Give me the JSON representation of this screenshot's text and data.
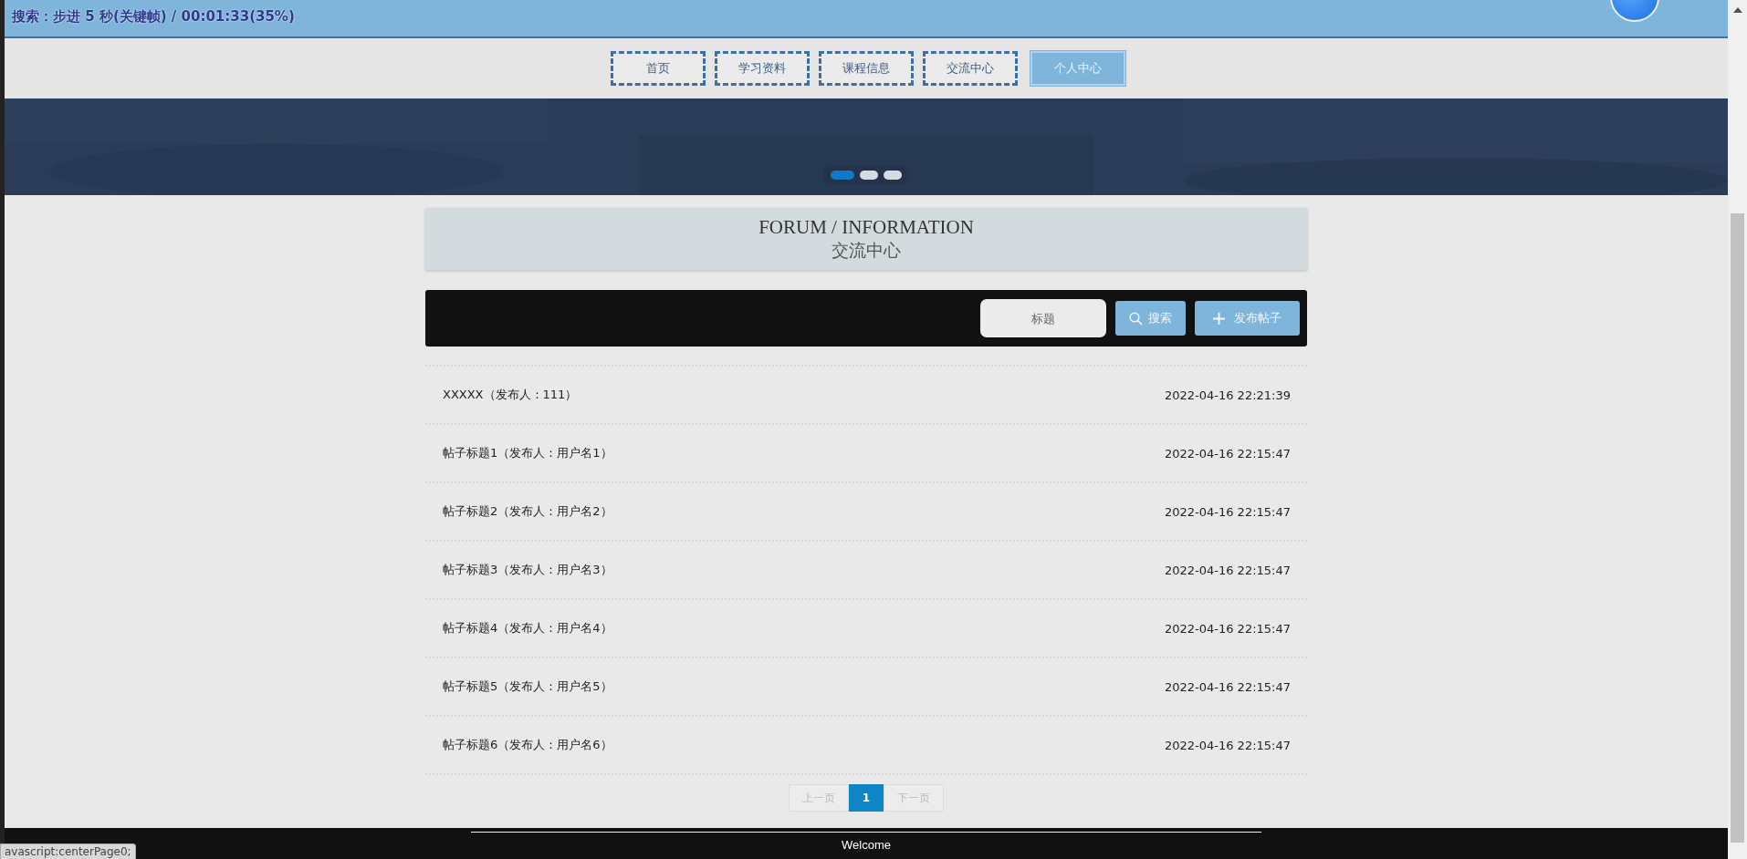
{
  "header": {
    "overlay_text": "搜索：步进 5 秒(关键帧) / 00:01:33(35%)"
  },
  "nav": [
    {
      "label": "首页",
      "selected": false
    },
    {
      "label": "学习资料",
      "selected": false
    },
    {
      "label": "课程信息",
      "selected": false
    },
    {
      "label": "交流中心",
      "selected": false
    },
    {
      "label": "个人中心",
      "selected": true
    }
  ],
  "banner": {
    "dots": [
      {
        "selected": true
      },
      {
        "selected": false
      },
      {
        "selected": false
      }
    ]
  },
  "section": {
    "title": "FORUM / INFORMATION",
    "subtitle": "交流中心"
  },
  "toolbar": {
    "search_placeholder": "标题",
    "search_button": "搜索",
    "post_button": "发布帖子"
  },
  "posts": [
    {
      "title": "XXXXX（发布人：111）",
      "time": "2022-04-16 22:21:39"
    },
    {
      "title": "帖子标题1（发布人：用户名1）",
      "time": "2022-04-16 22:15:47"
    },
    {
      "title": "帖子标题2（发布人：用户名2）",
      "time": "2022-04-16 22:15:47"
    },
    {
      "title": "帖子标题3（发布人：用户名3）",
      "time": "2022-04-16 22:15:47"
    },
    {
      "title": "帖子标题4（发布人：用户名4）",
      "time": "2022-04-16 22:15:47"
    },
    {
      "title": "帖子标题5（发布人：用户名5）",
      "time": "2022-04-16 22:15:47"
    },
    {
      "title": "帖子标题6（发布人：用户名6）",
      "time": "2022-04-16 22:15:47"
    }
  ],
  "pagination": {
    "prev": "上一页",
    "pages": [
      {
        "label": "1",
        "selected": true
      }
    ],
    "next": "下一页"
  },
  "footer": {
    "text": "Welcome"
  },
  "status_tooltip": "avascript:centerPage0;"
}
